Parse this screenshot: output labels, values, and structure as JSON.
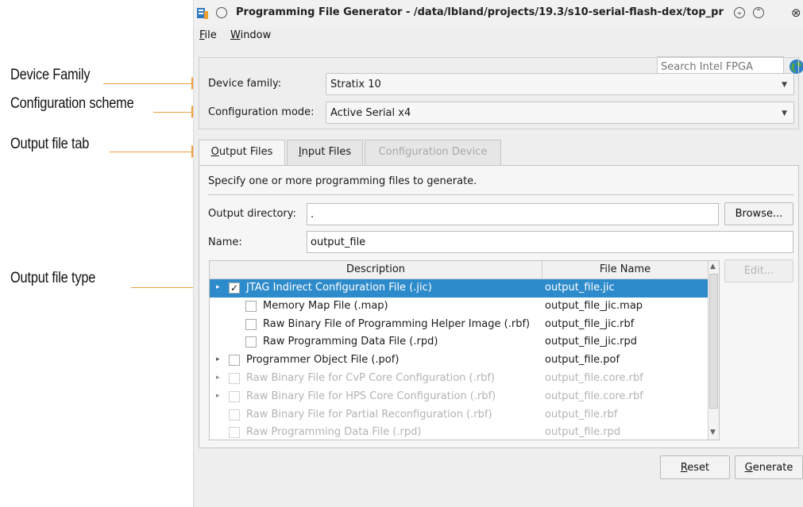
{
  "annotations": [
    {
      "label": "Device Family"
    },
    {
      "label": "Configuration scheme"
    },
    {
      "label": "Output file tab"
    },
    {
      "label": "Output file type"
    }
  ],
  "window": {
    "title": "Programming File Generator - /data/lbland/projects/19.3/s10-serial-flash-dex/top_pr",
    "minimize_glyph": "⌄",
    "maximize_glyph": "⌃",
    "close_glyph": "⊗"
  },
  "menu": {
    "file": {
      "mnemonic": "F",
      "rest": "ile"
    },
    "window": {
      "mnemonic": "W",
      "rest": "indow"
    }
  },
  "search": {
    "placeholder": "Search Intel FPGA"
  },
  "device": {
    "family_label": "Device family:",
    "family_value": "Stratix 10",
    "mode_label": "Configuration mode:",
    "mode_value": "Active Serial x4"
  },
  "tabs": [
    {
      "mnemonic": "O",
      "rest": "utput Files",
      "state": "active"
    },
    {
      "mnemonic": "I",
      "rest": "nput Files",
      "state": "normal"
    },
    {
      "label": "Configuration Device",
      "state": "disabled"
    }
  ],
  "output_tab": {
    "instruction": "Specify one or more programming files to generate.",
    "dir_label": "Output directory:",
    "dir_value": ".",
    "browse_label": "Browse...",
    "name_label": "Name:",
    "name_value": "output_file",
    "edit_label": "Edit..."
  },
  "table": {
    "columns": [
      "Description",
      "File Name"
    ],
    "rows": [
      {
        "desc": "JTAG Indirect Configuration File (.jic)",
        "file": "output_file.jic",
        "checked": true,
        "level": 0,
        "expander": "right",
        "state": "selected"
      },
      {
        "desc": "Memory Map File (.map)",
        "file": "output_file_jic.map",
        "checked": false,
        "level": 1,
        "expander": "",
        "state": "normal"
      },
      {
        "desc": "Raw Binary File of Programming Helper Image (.rbf)",
        "file": "output_file_jic.rbf",
        "checked": false,
        "level": 1,
        "expander": "",
        "state": "normal"
      },
      {
        "desc": "Raw Programming Data File (.rpd)",
        "file": "output_file_jic.rpd",
        "checked": false,
        "level": 1,
        "expander": "",
        "state": "normal"
      },
      {
        "desc": "Programmer Object File (.pof)",
        "file": "output_file.pof",
        "checked": false,
        "level": 0,
        "expander": "right",
        "state": "normal"
      },
      {
        "desc": "Raw Binary File for CvP Core Configuration (.rbf)",
        "file": "output_file.core.rbf",
        "checked": false,
        "level": 0,
        "expander": "right",
        "state": "disabled"
      },
      {
        "desc": "Raw Binary File for HPS Core Configuration (.rbf)",
        "file": "output_file.core.rbf",
        "checked": false,
        "level": 0,
        "expander": "right",
        "state": "disabled"
      },
      {
        "desc": "Raw Binary File for Partial Reconfiguration (.rbf)",
        "file": "output_file.rbf",
        "checked": false,
        "level": 0,
        "expander": "",
        "state": "disabled"
      },
      {
        "desc": "Raw Programming Data File (.rpd)",
        "file": "output_file.rpd",
        "checked": false,
        "level": 0,
        "expander": "",
        "state": "disabled"
      }
    ]
  },
  "footer": {
    "reset": {
      "mnemonic": "R",
      "rest": "eset"
    },
    "generate": {
      "mnemonic": "G",
      "rest": "enerate"
    }
  },
  "colors": {
    "annotation_arrow": "#f2a03a",
    "selection": "#2e8bcb"
  },
  "glyphs": {
    "check": "✓",
    "expander_right": "▸",
    "caret_down": "▼",
    "scroll_up": "▲",
    "scroll_down": "▼"
  }
}
